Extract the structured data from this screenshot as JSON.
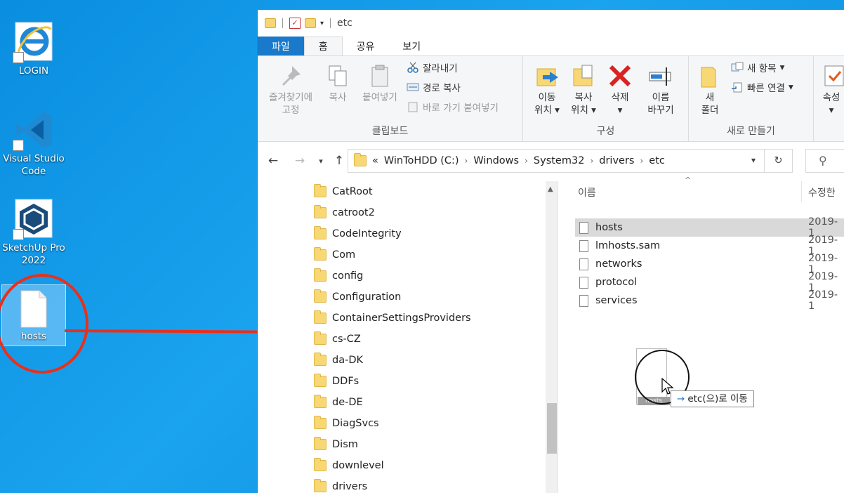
{
  "desktop": {
    "icons": [
      {
        "label": "LOGIN",
        "icon": "internet-explorer-icon"
      },
      {
        "label": "Visual Studio Code",
        "icon": "vscode-icon"
      },
      {
        "label": "SketchUp Pro 2022",
        "icon": "sketchup-icon"
      },
      {
        "label": "hosts",
        "icon": "file-icon"
      }
    ]
  },
  "window": {
    "title": "etc",
    "tabs": [
      "파일",
      "홈",
      "공유",
      "보기"
    ],
    "ribbon": {
      "pin_line1": "즐겨찾기에",
      "pin_line2": "고정",
      "copy": "복사",
      "paste": "붙여넣기",
      "cut": "잘라내기",
      "copy_path": "경로 복사",
      "paste_shortcut": "바로 가기 붙여넣기",
      "clipboard_group": "클립보드",
      "move_to_line1": "이동",
      "move_to_line2": "위치",
      "copy_to_line1": "복사",
      "copy_to_line2": "위치",
      "delete": "삭제",
      "rename_line1": "이름",
      "rename_line2": "바꾸기",
      "organize_group": "구성",
      "new_folder_line1": "새",
      "new_folder_line2": "폴더",
      "new_item": "새 항목",
      "easy_access": "빠른 연결",
      "new_group": "새로 만들기",
      "properties": "속성"
    },
    "address": {
      "overflow": "«",
      "crumbs": [
        "WinToHDD (C:)",
        "Windows",
        "System32",
        "drivers",
        "etc"
      ]
    },
    "nav_tree": [
      "CatRoot",
      "catroot2",
      "CodeIntegrity",
      "Com",
      "config",
      "Configuration",
      "ContainerSettingsProviders",
      "cs-CZ",
      "da-DK",
      "DDFs",
      "de-DE",
      "DiagSvcs",
      "Dism",
      "downlevel",
      "drivers"
    ],
    "columns": {
      "name": "이름",
      "modified": "수정한"
    },
    "files": [
      {
        "name": "hosts",
        "date": "2019-1",
        "selected": true
      },
      {
        "name": "lmhosts.sam",
        "date": "2019-1",
        "selected": false
      },
      {
        "name": "networks",
        "date": "2019-1",
        "selected": false
      },
      {
        "name": "protocol",
        "date": "2019-1",
        "selected": false
      },
      {
        "name": "services",
        "date": "2019-1",
        "selected": false
      }
    ]
  },
  "drag": {
    "tooltip": "etc(으)로 이동",
    "ghost_label": "hosts"
  },
  "colors": {
    "annotation": "#e8301c",
    "file_tab": "#1979ca",
    "desktop": "#0a8ee0"
  }
}
